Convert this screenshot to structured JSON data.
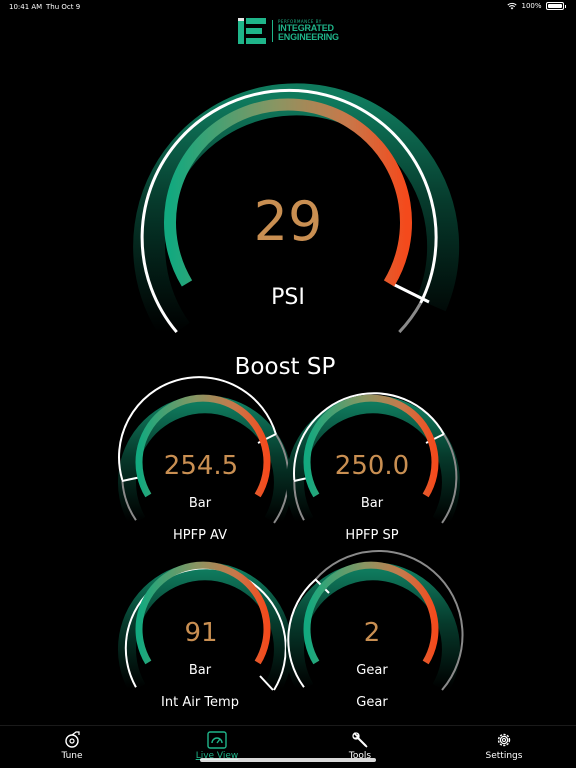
{
  "status": {
    "time": "10:41 AM",
    "date": "Thu Oct 9",
    "battery": "100%"
  },
  "logo": {
    "small": "PERFORMANCE BY",
    "line1": "INTEGRATED",
    "line2": "ENGINEERING"
  },
  "colors": {
    "accent": "#1fb58a",
    "value": "#c98f52",
    "redline": "#f04b1f"
  },
  "gauges": {
    "main": {
      "value": "29",
      "unit": "PSI",
      "label": "Boost SP"
    },
    "hpfp_av": {
      "value": "254.5",
      "unit": "Bar",
      "label": "HPFP AV"
    },
    "hpfp_sp": {
      "value": "250.0",
      "unit": "Bar",
      "label": "HPFP SP"
    },
    "iat": {
      "value": "91",
      "unit": "Bar",
      "label": "Int Air Temp"
    },
    "gear": {
      "value": "2",
      "unit": "Gear",
      "label": "Gear"
    }
  },
  "tabs": [
    {
      "label": "Tune",
      "icon": "turbo-icon",
      "active": false
    },
    {
      "label": "Live View",
      "icon": "gauge-icon",
      "active": true
    },
    {
      "label": "Tools",
      "icon": "wrench-icon",
      "active": false
    },
    {
      "label": "Settings",
      "icon": "gear-icon",
      "active": false
    }
  ]
}
